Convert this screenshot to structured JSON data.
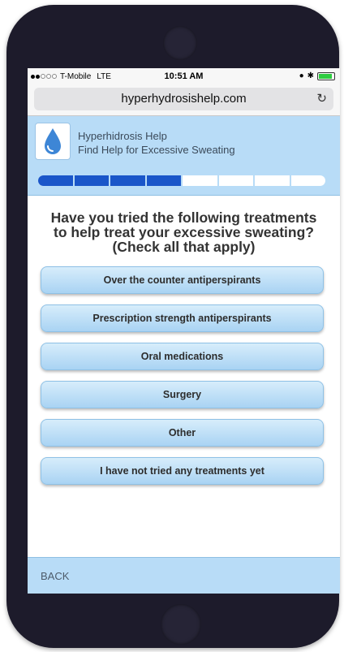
{
  "status_bar": {
    "carrier": "T-Mobile",
    "network": "LTE",
    "time": "10:51 AM",
    "bluetooth": "✱"
  },
  "browser": {
    "url": "hyperhydrosishelp.com",
    "reload_icon": "reload-icon"
  },
  "app": {
    "title": "Hyperhidrosis Help",
    "subtitle": "Find Help for Excessive Sweating",
    "logo_icon": "water-drop-icon",
    "progress": {
      "completed_steps": 4,
      "total_steps": 8
    }
  },
  "question": {
    "line1": "Have you tried the following treatments",
    "line2": "to help treat your excessive sweating?",
    "line3": "(Check all that apply)"
  },
  "options": [
    "Over the counter antiperspirants",
    "Prescription strength antiperspirants",
    "Oral medications",
    "Surgery",
    "Other",
    "I have not tried any treatments yet"
  ],
  "footer": {
    "back_label": "BACK"
  },
  "colors": {
    "phone_body": "#1d1b2b",
    "header_bg": "#b8dcf7",
    "progress_done": "#1a56c9",
    "button_top": "#d7edfb",
    "button_bottom": "#a9d3f3"
  }
}
